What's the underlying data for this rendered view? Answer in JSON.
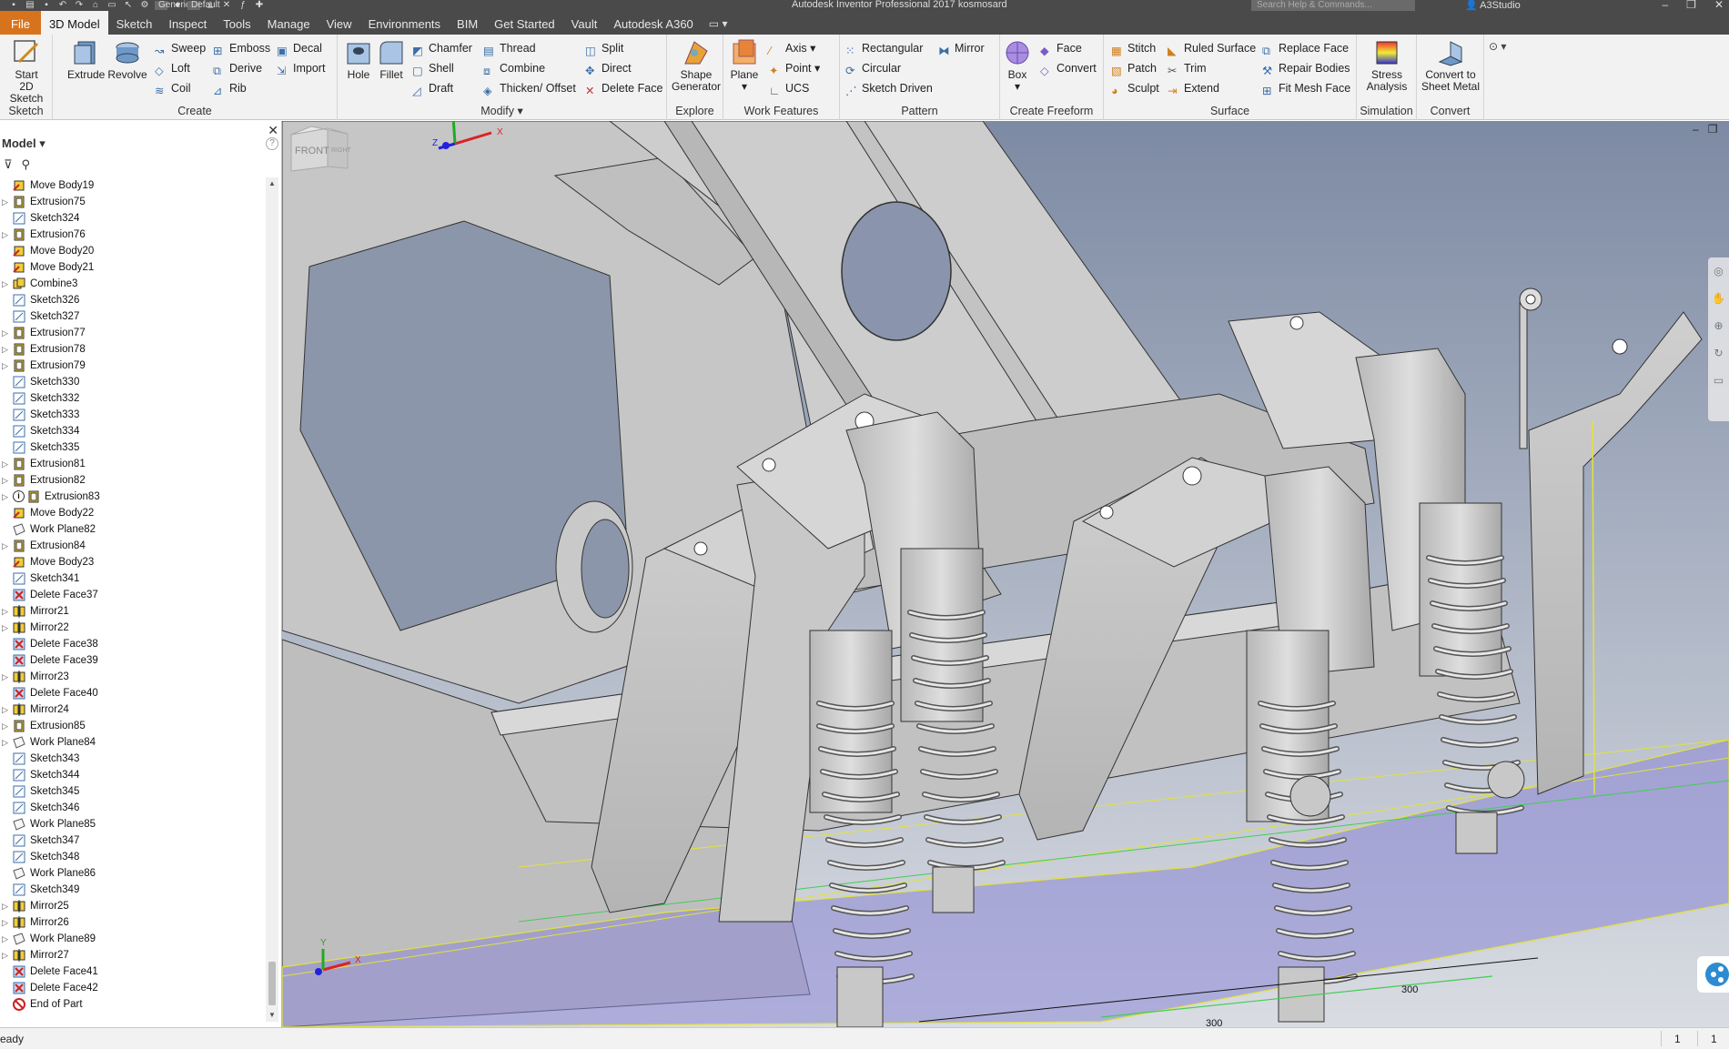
{
  "window": {
    "title": "Autodesk Inventor Professional 2017    kosmosard",
    "qat_material": "Generic",
    "qat_appearance": "Default",
    "search_placeholder": "Search Help & Commands...",
    "user": "A3Studio"
  },
  "tabs": [
    {
      "label": "File",
      "kind": "file"
    },
    {
      "label": "3D Model",
      "kind": "active"
    },
    {
      "label": "Sketch"
    },
    {
      "label": "Inspect"
    },
    {
      "label": "Tools"
    },
    {
      "label": "Manage"
    },
    {
      "label": "View"
    },
    {
      "label": "Environments"
    },
    {
      "label": "BIM"
    },
    {
      "label": "Get Started"
    },
    {
      "label": "Vault"
    },
    {
      "label": "Autodesk A360"
    }
  ],
  "ribbon": {
    "sketch": {
      "label": "Sketch",
      "start_line1": "Start",
      "start_line2": "2D Sketch"
    },
    "create": {
      "label": "Create",
      "extrude": "Extrude",
      "revolve": "Revolve",
      "sweep": "Sweep",
      "loft": "Loft",
      "coil": "Coil",
      "emboss": "Emboss",
      "derive": "Derive",
      "rib": "Rib",
      "decal": "Decal",
      "import": "Import"
    },
    "modify": {
      "label": "Modify",
      "hole": "Hole",
      "fillet": "Fillet",
      "chamfer": "Chamfer",
      "shell": "Shell",
      "draft": "Draft",
      "thread": "Thread",
      "combine": "Combine",
      "thicken": "Thicken/ Offset",
      "split": "Split",
      "direct": "Direct",
      "delete_face": "Delete Face"
    },
    "explore": {
      "label": "Explore",
      "shape_line1": "Shape",
      "shape_line2": "Generator"
    },
    "work": {
      "label": "Work Features",
      "plane": "Plane",
      "axis": "Axis",
      "point": "Point",
      "ucs": "UCS"
    },
    "pattern": {
      "label": "Pattern",
      "rectangular": "Rectangular",
      "circular": "Circular",
      "sketch_driven": "Sketch Driven",
      "mirror": "Mirror"
    },
    "freeform": {
      "label": "Create Freeform",
      "box": "Box",
      "face": "Face",
      "convert": "Convert"
    },
    "surface": {
      "label": "Surface",
      "stitch": "Stitch",
      "patch": "Patch",
      "sculpt": "Sculpt",
      "ruled": "Ruled Surface",
      "trim": "Trim",
      "extend": "Extend",
      "replace": "Replace Face",
      "repair": "Repair Bodies",
      "fitmesh": "Fit Mesh Face"
    },
    "simulation": {
      "label": "Simulation",
      "stress_line1": "Stress",
      "stress_line2": "Analysis"
    },
    "convert": {
      "label": "Convert",
      "sheet_line1": "Convert to",
      "sheet_line2": "Sheet Metal"
    }
  },
  "browser": {
    "title": "Model",
    "nodes": [
      {
        "label": "Move Body19",
        "type": "move",
        "exp": false
      },
      {
        "label": "Extrusion75",
        "type": "extrude",
        "exp": true
      },
      {
        "label": "Sketch324",
        "type": "sketch",
        "exp": false
      },
      {
        "label": "Extrusion76",
        "type": "extrude",
        "exp": true
      },
      {
        "label": "Move Body20",
        "type": "move",
        "exp": false
      },
      {
        "label": "Move Body21",
        "type": "move",
        "exp": false
      },
      {
        "label": "Combine3",
        "type": "combine",
        "exp": true
      },
      {
        "label": "Sketch326",
        "type": "sketch",
        "exp": false
      },
      {
        "label": "Sketch327",
        "type": "sketch",
        "exp": false
      },
      {
        "label": "Extrusion77",
        "type": "extrude",
        "exp": true
      },
      {
        "label": "Extrusion78",
        "type": "extrude",
        "exp": true
      },
      {
        "label": "Extrusion79",
        "type": "extrude",
        "exp": true
      },
      {
        "label": "Sketch330",
        "type": "sketch",
        "exp": false
      },
      {
        "label": "Sketch332",
        "type": "sketch",
        "exp": false
      },
      {
        "label": "Sketch333",
        "type": "sketch",
        "exp": false
      },
      {
        "label": "Sketch334",
        "type": "sketch",
        "exp": false
      },
      {
        "label": "Sketch335",
        "type": "sketch",
        "exp": false
      },
      {
        "label": "Extrusion81",
        "type": "extrude",
        "exp": true
      },
      {
        "label": "Extrusion82",
        "type": "extrude",
        "exp": true
      },
      {
        "label": "Extrusion83",
        "type": "extrude",
        "exp": true,
        "warn": true
      },
      {
        "label": "Move Body22",
        "type": "move",
        "exp": false
      },
      {
        "label": "Work Plane82",
        "type": "plane",
        "exp": false
      },
      {
        "label": "Extrusion84",
        "type": "extrude",
        "exp": true
      },
      {
        "label": "Move Body23",
        "type": "move",
        "exp": false
      },
      {
        "label": "Sketch341",
        "type": "sketch",
        "exp": false
      },
      {
        "label": "Delete Face37",
        "type": "delete",
        "exp": false
      },
      {
        "label": "Mirror21",
        "type": "mirror",
        "exp": true
      },
      {
        "label": "Mirror22",
        "type": "mirror",
        "exp": true
      },
      {
        "label": "Delete Face38",
        "type": "delete",
        "exp": false
      },
      {
        "label": "Delete Face39",
        "type": "delete",
        "exp": false
      },
      {
        "label": "Mirror23",
        "type": "mirror",
        "exp": true
      },
      {
        "label": "Delete Face40",
        "type": "delete",
        "exp": false
      },
      {
        "label": "Mirror24",
        "type": "mirror",
        "exp": true
      },
      {
        "label": "Extrusion85",
        "type": "extrude",
        "exp": true
      },
      {
        "label": "Work Plane84",
        "type": "plane",
        "exp": true
      },
      {
        "label": "Sketch343",
        "type": "sketch",
        "exp": false
      },
      {
        "label": "Sketch344",
        "type": "sketch",
        "exp": false
      },
      {
        "label": "Sketch345",
        "type": "sketch",
        "exp": false
      },
      {
        "label": "Sketch346",
        "type": "sketch",
        "exp": false
      },
      {
        "label": "Work Plane85",
        "type": "plane",
        "exp": false
      },
      {
        "label": "Sketch347",
        "type": "sketch",
        "exp": false
      },
      {
        "label": "Sketch348",
        "type": "sketch",
        "exp": false
      },
      {
        "label": "Work Plane86",
        "type": "plane",
        "exp": false
      },
      {
        "label": "Sketch349",
        "type": "sketch",
        "exp": false
      },
      {
        "label": "Mirror25",
        "type": "mirror",
        "exp": true
      },
      {
        "label": "Mirror26",
        "type": "mirror",
        "exp": true
      },
      {
        "label": "Work Plane89",
        "type": "plane",
        "exp": true
      },
      {
        "label": "Mirror27",
        "type": "mirror",
        "exp": true
      },
      {
        "label": "Delete Face41",
        "type": "delete",
        "exp": false
      },
      {
        "label": "Delete Face42",
        "type": "delete",
        "exp": false
      },
      {
        "label": "End of Part",
        "type": "end",
        "exp": false
      }
    ]
  },
  "viewport": {
    "viewcube_front": "FRONT",
    "viewcube_right": "RIGHT",
    "dim_a": "300",
    "dim_b": "300"
  },
  "status": {
    "text": "eady",
    "count1": "1",
    "count2": "1"
  },
  "colors": {
    "file_tab": "#d8731d",
    "work_plane": "#8b86d6",
    "model_gray": "#c9c9c9"
  }
}
